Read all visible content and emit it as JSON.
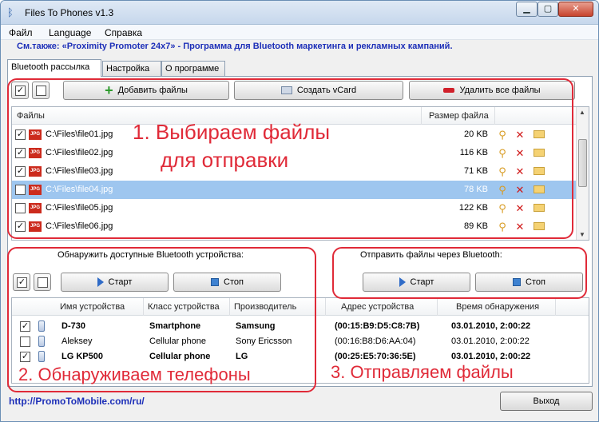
{
  "window": {
    "title": "Files To Phones v1.3",
    "min_glyph": "▁",
    "max_glyph": "▢",
    "close_glyph": "✕"
  },
  "menu": [
    "Файл",
    "Language",
    "Справка"
  ],
  "promo": "См.также: «Proximity Promoter 24x7» - Программа для Bluetooth маркетинга и рекламных кампаний.",
  "tabs": [
    "Bluetooth рассылка",
    "Настройка",
    "О программе"
  ],
  "files_toolbar": {
    "add": "Добавить файлы",
    "vcard": "Создать vCard",
    "delete_all": "Удалить все файлы"
  },
  "files_table": {
    "col_files": "Файлы",
    "col_size": "Размер файла",
    "rows": [
      {
        "checked": true,
        "path": "C:\\Files\\file01.jpg",
        "size": "20 KB",
        "selected": false
      },
      {
        "checked": true,
        "path": "C:\\Files\\file02.jpg",
        "size": "116 KB",
        "selected": false
      },
      {
        "checked": true,
        "path": "C:\\Files\\file03.jpg",
        "size": "71 KB",
        "selected": false
      },
      {
        "checked": false,
        "path": "C:\\Files\\file04.jpg",
        "size": "78 KB",
        "selected": true
      },
      {
        "checked": false,
        "path": "C:\\Files\\file05.jpg",
        "size": "122 KB",
        "selected": false
      },
      {
        "checked": true,
        "path": "C:\\Files\\file06.jpg",
        "size": "89 KB",
        "selected": false
      }
    ]
  },
  "discover": {
    "label": "Обнаружить доступные Bluetooth устройства:",
    "start": "Старт",
    "stop": "Стоп"
  },
  "send": {
    "label": "Отправить файлы через Bluetooth:",
    "start": "Старт",
    "stop": "Стоп"
  },
  "devices_table": {
    "col_name": "Имя устройства",
    "col_class": "Класс устройства",
    "col_vendor": "Производитель",
    "col_address": "Адрес устройства",
    "col_time": "Время обнаружения",
    "rows": [
      {
        "checked": true,
        "name": "D-730",
        "class": "Smartphone",
        "vendor": "Samsung",
        "address": "(00:15:B9:D5:C8:7B)",
        "time": "03.01.2010, 2:00:22",
        "bold": true
      },
      {
        "checked": false,
        "name": "Aleksey",
        "class": "Cellular phone",
        "vendor": "Sony Ericsson",
        "address": "(00:16:B8:D6:AA:04)",
        "time": "03.01.2010, 2:00:22",
        "bold": false
      },
      {
        "checked": true,
        "name": "LG KP500",
        "class": "Cellular phone",
        "vendor": "LG",
        "address": "(00:25:E5:70:36:5E)",
        "time": "03.01.2010, 2:00:22",
        "bold": true
      }
    ]
  },
  "annotations": {
    "step1_line1": "1. Выбираем файлы",
    "step1_line2": "для отправки",
    "step2": "2. Обнаруживаем телефоны",
    "step3": "3. Отправляем файлы"
  },
  "footer": {
    "link": "http://PromoToMobile.com/ru/",
    "exit": "Выход"
  },
  "colors": {
    "annotation_red": "#e02a38",
    "promo_blue": "#1d2fb8",
    "selection": "#9ec6ef"
  }
}
